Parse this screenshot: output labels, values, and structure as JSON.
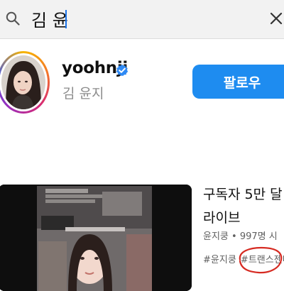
{
  "search": {
    "query": "김 윤",
    "icon": "search-icon",
    "clear_icon": "close-icon"
  },
  "channel": {
    "name": "yoohnji",
    "handle": "김 윤지",
    "verified_icon": "verified-check-icon",
    "follow_label": "팔로우",
    "accent_color": "#1e8cf0"
  },
  "video": {
    "title": "구독자 5만 달\n라이브",
    "channel": "윤지쿵",
    "separator": "•",
    "views": "997명 시",
    "tags": [
      "#윤지쿵",
      "#트랜스젠더"
    ]
  }
}
